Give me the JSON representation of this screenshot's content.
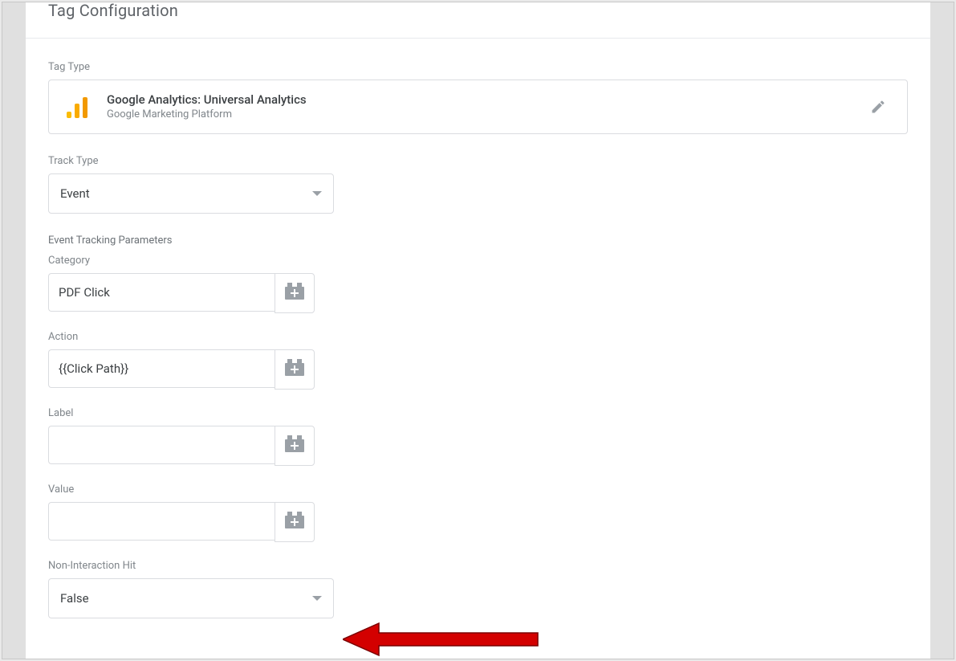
{
  "section": {
    "title": "Tag Configuration"
  },
  "tagType": {
    "label": "Tag Type",
    "title": "Google Analytics: Universal Analytics",
    "subtitle": "Google Marketing Platform"
  },
  "trackType": {
    "label": "Track Type",
    "value": "Event"
  },
  "params": {
    "heading": "Event Tracking Parameters",
    "category": {
      "label": "Category",
      "value": "PDF Click"
    },
    "action": {
      "label": "Action",
      "value": "{{Click Path}}"
    },
    "labelField": {
      "label": "Label",
      "value": ""
    },
    "valueField": {
      "label": "Value",
      "value": ""
    }
  },
  "nonInteraction": {
    "label": "Non-Interaction Hit",
    "value": "False"
  }
}
